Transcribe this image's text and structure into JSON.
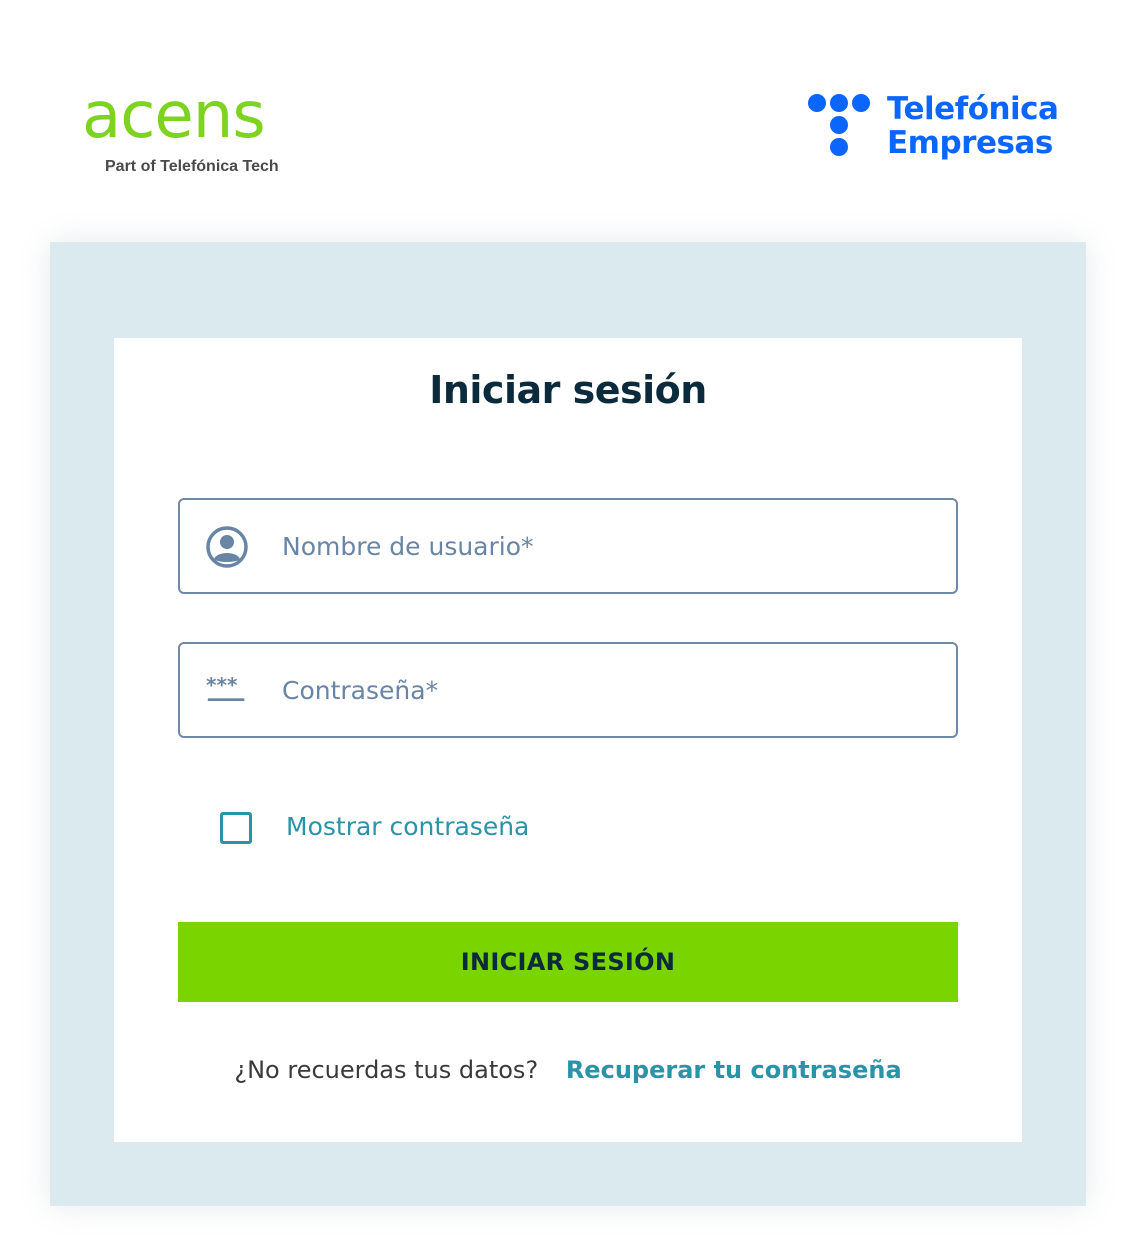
{
  "header": {
    "left_logo": {
      "wordmark": "acens",
      "tagline": "Part of Telefónica Tech",
      "color": "#7ed321"
    },
    "right_logo": {
      "line1": "Telefónica",
      "line2": "Empresas",
      "color": "#0b66ff"
    }
  },
  "login": {
    "title": "Iniciar sesión",
    "username": {
      "placeholder": "Nombre de usuario*",
      "value": "",
      "icon": "user-circle-icon"
    },
    "password": {
      "placeholder": "Contraseña*",
      "value": "",
      "icon": "password-asterisks-icon"
    },
    "show_password": {
      "label": "Mostrar contraseña",
      "checked": false
    },
    "submit_label": "INICIAR SESIÓN",
    "forgot": {
      "question": "¿No recuerdas tus datos?",
      "link": "Recuperar tu contraseña"
    }
  },
  "colors": {
    "accent_green": "#79d400",
    "panel_bg": "#dbeaee",
    "title": "#0b2b3d",
    "link": "#2a93a8",
    "field_border": "#6f8aa8"
  }
}
